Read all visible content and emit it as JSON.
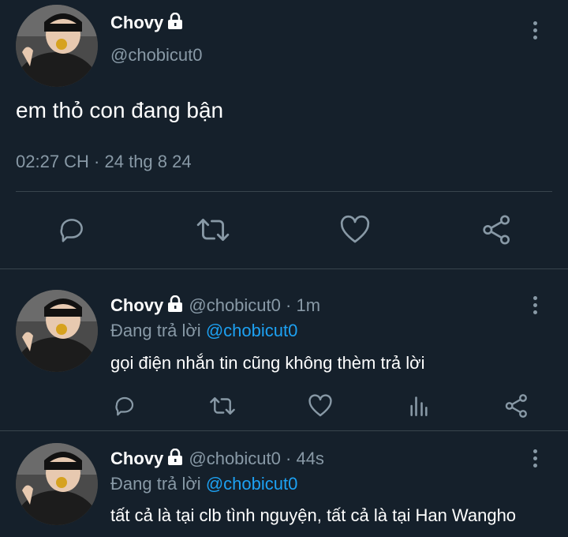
{
  "main_tweet": {
    "display_name": "Chovy",
    "handle": "@chobicut0",
    "text": "em thỏ con đang bận",
    "timestamp": "02:27 CH · 24 thg 8 24",
    "actions": [
      "reply-icon",
      "retweet-icon",
      "like-icon",
      "share-icon"
    ]
  },
  "replies": [
    {
      "display_name": "Chovy",
      "handle": "@chobicut0",
      "time": "· 1m",
      "replying_prefix": "Đang trả lời",
      "replying_to": "@chobicut0",
      "text": "gọi điện nhắn tin cũng không thèm trả lời",
      "actions": [
        "reply-icon",
        "retweet-icon",
        "like-icon",
        "analytics-icon",
        "share-icon"
      ]
    },
    {
      "display_name": "Chovy",
      "handle": "@chobicut0",
      "time": "· 44s",
      "replying_prefix": "Đang trả lời",
      "replying_to": "@chobicut0",
      "text": "tất cả là tại clb tình nguyện, tất cả là tại Han Wangho"
    }
  ],
  "colors": {
    "background": "#15202b",
    "secondary_text": "#8899a6",
    "mention": "#1da1f2",
    "border": "#38444d"
  }
}
